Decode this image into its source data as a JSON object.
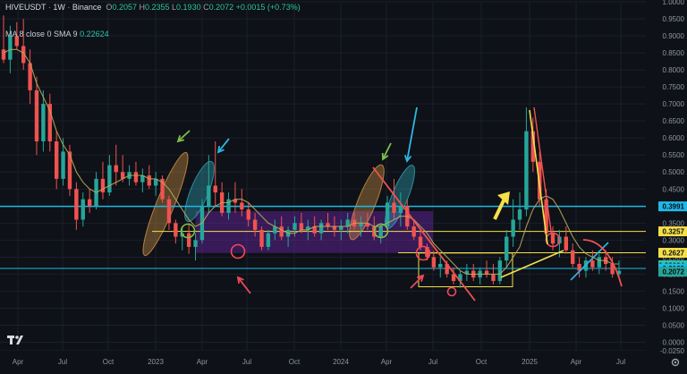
{
  "header": {
    "symbol": "HIVEUSDT",
    "timeframe": "1W",
    "exchange": "Binance",
    "open_label": "O",
    "open": "0.2057",
    "high_label": "H",
    "high": "0.2355",
    "low_label": "L",
    "low": "0.1930",
    "close_label": "C",
    "close": "0.2072",
    "change": "+0.0015 (+0.73%)"
  },
  "indicator": {
    "label": "MA 8 close 0 SMA 9",
    "value": "0.22624"
  },
  "colors": {
    "background": "#0e1117",
    "up": "#26a69a",
    "down": "#ef5350",
    "ma": "#b8a85a",
    "cyan_line": "#1fb8e8",
    "yellow": "#f5e04a",
    "purple_zone": "#7b2bc0"
  },
  "chart_data": {
    "type": "candlestick",
    "symbol": "HIVEUSDT",
    "interval": "1W",
    "ylim": [
      -0.025,
      1.0
    ],
    "y_ticks": [
      "1.0000",
      "0.9500",
      "0.9000",
      "0.8500",
      "0.8000",
      "0.7500",
      "0.7000",
      "0.6500",
      "0.6000",
      "0.5500",
      "0.5000",
      "0.4500",
      "0.3500",
      "0.3000",
      "0.2500",
      "0.2000",
      "0.1500",
      "0.1000",
      "0.0500",
      "0.0000",
      "-0.0250"
    ],
    "x_ticks": [
      "Apr",
      "Jul",
      "Oct",
      "2023",
      "Apr",
      "Jul",
      "Oct",
      "2024",
      "Apr",
      "Jul",
      "Oct",
      "2025",
      "Apr",
      "Jul"
    ],
    "price_labels": [
      {
        "text": "0.3991",
        "value": 0.3991,
        "color": "#1fb8e8"
      },
      {
        "text": "0.3257",
        "value": 0.3257,
        "color": "#f5e04a"
      },
      {
        "text": "0.2627",
        "value": 0.2627,
        "color": "#f5e04a"
      },
      {
        "text": "0.22624",
        "value": 0.22624,
        "color": "#2ec4a6"
      },
      {
        "text": "0.2169",
        "value": 0.2169,
        "color": "#1fb8e8"
      },
      {
        "text": "0.2072",
        "value": 0.2072,
        "color": "#26a69a"
      }
    ],
    "horizontal_lines": [
      {
        "value": 0.3991,
        "color": "#1fb8e8"
      },
      {
        "value": 0.3257,
        "color": "#f5e04a"
      },
      {
        "value": 0.2627,
        "color": "#f5e04a"
      },
      {
        "value": 0.2169,
        "color": "#1fb8e8"
      }
    ],
    "candles": [
      [
        0.86,
        0.96,
        0.82,
        0.83
      ],
      [
        0.83,
        0.93,
        0.79,
        0.9
      ],
      [
        0.9,
        0.94,
        0.86,
        0.87
      ],
      [
        0.87,
        0.95,
        0.8,
        0.82
      ],
      [
        0.82,
        0.86,
        0.7,
        0.74
      ],
      [
        0.74,
        0.78,
        0.55,
        0.59
      ],
      [
        0.59,
        0.74,
        0.56,
        0.7
      ],
      [
        0.7,
        0.73,
        0.56,
        0.59
      ],
      [
        0.59,
        0.62,
        0.45,
        0.48
      ],
      [
        0.48,
        0.6,
        0.46,
        0.56
      ],
      [
        0.56,
        0.58,
        0.43,
        0.45
      ],
      [
        0.45,
        0.47,
        0.33,
        0.36
      ],
      [
        0.36,
        0.44,
        0.34,
        0.42
      ],
      [
        0.42,
        0.45,
        0.38,
        0.4
      ],
      [
        0.4,
        0.5,
        0.39,
        0.48
      ],
      [
        0.48,
        0.53,
        0.42,
        0.44
      ],
      [
        0.44,
        0.55,
        0.43,
        0.52
      ],
      [
        0.52,
        0.58,
        0.46,
        0.5
      ],
      [
        0.5,
        0.55,
        0.47,
        0.48
      ],
      [
        0.48,
        0.52,
        0.46,
        0.5
      ],
      [
        0.5,
        0.53,
        0.46,
        0.47
      ],
      [
        0.47,
        0.51,
        0.44,
        0.49
      ],
      [
        0.49,
        0.52,
        0.45,
        0.46
      ],
      [
        0.46,
        0.5,
        0.43,
        0.48
      ],
      [
        0.48,
        0.49,
        0.41,
        0.42
      ],
      [
        0.42,
        0.43,
        0.33,
        0.35
      ],
      [
        0.35,
        0.36,
        0.29,
        0.31
      ],
      [
        0.31,
        0.34,
        0.27,
        0.32
      ],
      [
        0.32,
        0.35,
        0.26,
        0.28
      ],
      [
        0.28,
        0.32,
        0.24,
        0.3
      ],
      [
        0.3,
        0.42,
        0.29,
        0.4
      ],
      [
        0.4,
        0.55,
        0.38,
        0.46
      ],
      [
        0.46,
        0.59,
        0.4,
        0.44
      ],
      [
        0.44,
        0.47,
        0.37,
        0.38
      ],
      [
        0.38,
        0.44,
        0.36,
        0.42
      ],
      [
        0.42,
        0.47,
        0.38,
        0.41
      ],
      [
        0.41,
        0.45,
        0.37,
        0.39
      ],
      [
        0.39,
        0.41,
        0.34,
        0.36
      ],
      [
        0.36,
        0.38,
        0.31,
        0.33
      ],
      [
        0.33,
        0.34,
        0.27,
        0.28
      ],
      [
        0.28,
        0.33,
        0.27,
        0.32
      ],
      [
        0.32,
        0.36,
        0.3,
        0.34
      ],
      [
        0.34,
        0.37,
        0.3,
        0.31
      ],
      [
        0.31,
        0.34,
        0.28,
        0.33
      ],
      [
        0.33,
        0.37,
        0.31,
        0.35
      ],
      [
        0.35,
        0.38,
        0.32,
        0.33
      ],
      [
        0.33,
        0.36,
        0.3,
        0.34
      ],
      [
        0.34,
        0.37,
        0.31,
        0.32
      ],
      [
        0.32,
        0.36,
        0.3,
        0.35
      ],
      [
        0.35,
        0.38,
        0.33,
        0.34
      ],
      [
        0.34,
        0.37,
        0.31,
        0.33
      ],
      [
        0.33,
        0.36,
        0.3,
        0.34
      ],
      [
        0.34,
        0.38,
        0.32,
        0.36
      ],
      [
        0.36,
        0.38,
        0.33,
        0.34
      ],
      [
        0.34,
        0.37,
        0.31,
        0.35
      ],
      [
        0.35,
        0.38,
        0.33,
        0.34
      ],
      [
        0.34,
        0.37,
        0.3,
        0.31
      ],
      [
        0.31,
        0.35,
        0.29,
        0.34
      ],
      [
        0.34,
        0.43,
        0.33,
        0.41
      ],
      [
        0.41,
        0.48,
        0.36,
        0.38
      ],
      [
        0.38,
        0.44,
        0.34,
        0.4
      ],
      [
        0.4,
        0.42,
        0.33,
        0.34
      ],
      [
        0.34,
        0.36,
        0.3,
        0.31
      ],
      [
        0.31,
        0.33,
        0.27,
        0.28
      ],
      [
        0.28,
        0.29,
        0.24,
        0.25
      ],
      [
        0.25,
        0.27,
        0.21,
        0.22
      ],
      [
        0.22,
        0.25,
        0.19,
        0.23
      ],
      [
        0.23,
        0.24,
        0.19,
        0.2
      ],
      [
        0.2,
        0.22,
        0.17,
        0.18
      ],
      [
        0.18,
        0.21,
        0.16,
        0.2
      ],
      [
        0.2,
        0.23,
        0.18,
        0.21
      ],
      [
        0.21,
        0.23,
        0.18,
        0.19
      ],
      [
        0.19,
        0.22,
        0.17,
        0.21
      ],
      [
        0.21,
        0.24,
        0.19,
        0.2
      ],
      [
        0.2,
        0.23,
        0.17,
        0.18
      ],
      [
        0.18,
        0.25,
        0.17,
        0.24
      ],
      [
        0.24,
        0.33,
        0.22,
        0.31
      ],
      [
        0.31,
        0.42,
        0.28,
        0.36
      ],
      [
        0.36,
        0.44,
        0.33,
        0.39
      ],
      [
        0.39,
        0.69,
        0.37,
        0.62
      ],
      [
        0.62,
        0.66,
        0.5,
        0.53
      ],
      [
        0.53,
        0.56,
        0.4,
        0.42
      ],
      [
        0.42,
        0.45,
        0.3,
        0.32
      ],
      [
        0.32,
        0.34,
        0.27,
        0.29
      ],
      [
        0.29,
        0.33,
        0.25,
        0.31
      ],
      [
        0.31,
        0.34,
        0.26,
        0.27
      ],
      [
        0.27,
        0.29,
        0.22,
        0.23
      ],
      [
        0.23,
        0.25,
        0.19,
        0.21
      ],
      [
        0.21,
        0.25,
        0.19,
        0.24
      ],
      [
        0.24,
        0.27,
        0.21,
        0.22
      ],
      [
        0.22,
        0.26,
        0.2,
        0.25
      ],
      [
        0.25,
        0.27,
        0.21,
        0.23
      ],
      [
        0.23,
        0.25,
        0.19,
        0.2
      ],
      [
        0.2,
        0.24,
        0.19,
        0.21
      ]
    ],
    "ma": [
      0.85,
      0.86,
      0.86,
      0.85,
      0.82,
      0.76,
      0.72,
      0.68,
      0.62,
      0.58,
      0.55,
      0.5,
      0.47,
      0.45,
      0.44,
      0.45,
      0.46,
      0.47,
      0.48,
      0.49,
      0.49,
      0.49,
      0.48,
      0.48,
      0.47,
      0.45,
      0.42,
      0.39,
      0.36,
      0.34,
      0.35,
      0.38,
      0.4,
      0.41,
      0.41,
      0.42,
      0.42,
      0.41,
      0.39,
      0.37,
      0.35,
      0.34,
      0.33,
      0.32,
      0.32,
      0.33,
      0.33,
      0.34,
      0.34,
      0.34,
      0.34,
      0.34,
      0.34,
      0.35,
      0.35,
      0.35,
      0.34,
      0.34,
      0.35,
      0.36,
      0.37,
      0.37,
      0.36,
      0.34,
      0.32,
      0.29,
      0.27,
      0.25,
      0.23,
      0.21,
      0.2,
      0.2,
      0.2,
      0.2,
      0.2,
      0.2,
      0.22,
      0.25,
      0.28,
      0.34,
      0.39,
      0.42,
      0.43,
      0.42,
      0.39,
      0.35,
      0.31,
      0.28,
      0.26,
      0.25,
      0.24,
      0.24,
      0.23,
      0.23
    ]
  }
}
